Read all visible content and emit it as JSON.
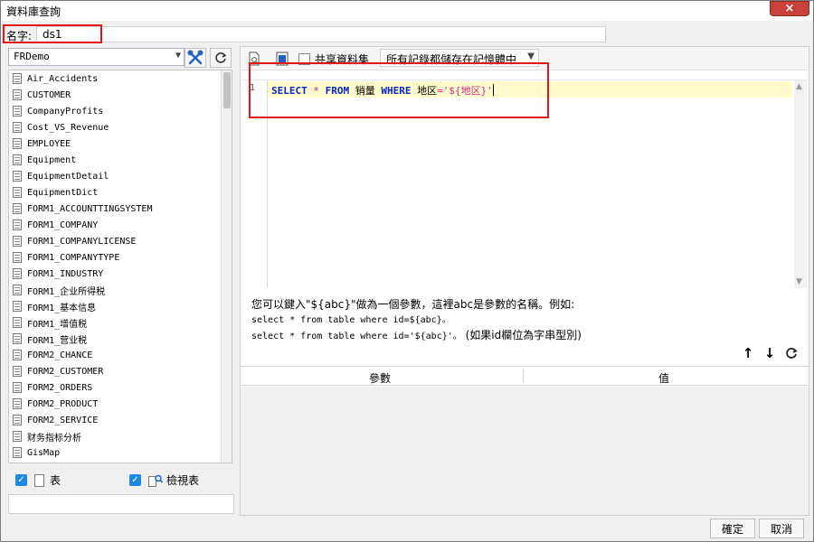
{
  "window": {
    "title": "資料庫查詢",
    "close_glyph": "×"
  },
  "name_field": {
    "label": "名字:",
    "value": "ds1"
  },
  "left": {
    "connection": "FRDemo",
    "tables": [
      "Air_Accidents",
      "CUSTOMER",
      "CompanyProfits",
      "Cost_VS_Revenue",
      "EMPLOYEE",
      "Equipment",
      "EquipmentDetail",
      "EquipmentDict",
      "FORM1_ACCOUNTTINGSYSTEM",
      "FORM1_COMPANY",
      "FORM1_COMPANYLICENSE",
      "FORM1_COMPANYTYPE",
      "FORM1_INDUSTRY",
      "FORM1_企业所得税",
      "FORM1_基本信息",
      "FORM1_增值税",
      "FORM1_营业税",
      "FORM2_CHANCE",
      "FORM2_CUSTOMER",
      "FORM2_ORDERS",
      "FORM2_PRODUCT",
      "FORM2_SERVICE",
      "财务指标分析",
      "GisMap"
    ],
    "table_check_label": "表",
    "view_check_label": "檢視表"
  },
  "sql": {
    "share_label": "共享資料集",
    "mem_option": "所有記錄都儲存在記憶體中",
    "line_number": "1",
    "kw_select": "SELECT",
    "star": "*",
    "kw_from": "FROM",
    "table": "销量",
    "kw_where": "WHERE",
    "field": "地区",
    "eq": "=",
    "quote_open": "'",
    "param": "${地区}",
    "quote_close": "'"
  },
  "help": {
    "line1": "您可以鍵入\"${abc}\"做為一個參數，這裡abc是參數的名稱。例如:",
    "line2": "select * from table where id=${abc}。",
    "line3_code": "select * from table where id='${abc}'。",
    "line3_note": "(如果id欄位為字串型別)"
  },
  "params": {
    "col_param": "參數",
    "col_value": "值"
  },
  "footer": {
    "ok": "確定",
    "cancel": "取消"
  }
}
